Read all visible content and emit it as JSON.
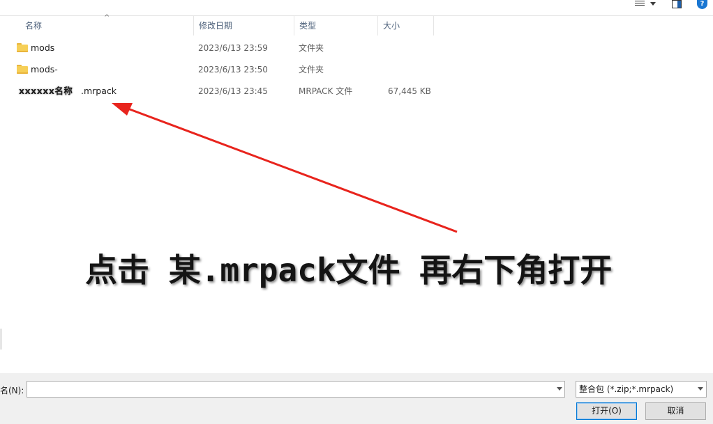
{
  "columns": {
    "name": "名称",
    "modified": "修改日期",
    "type": "类型",
    "size": "大小"
  },
  "sort_indicator": "^",
  "files": [
    {
      "name": "mods",
      "modified": "2023/6/13 23:59",
      "type": "文件夹",
      "size": "",
      "icon": "folder-icon"
    },
    {
      "name": "mods-",
      "modified": "2023/6/13 23:50",
      "type": "文件夹",
      "size": "",
      "icon": "folder-icon"
    },
    {
      "name_prefix": "xxxxxx名称",
      "name_suffix": ".mrpack",
      "modified": "2023/6/13 23:45",
      "type": "MRPACK 文件",
      "size": "67,445 KB",
      "icon": "none"
    }
  ],
  "annotation": {
    "text": "点击 某.mrpack文件 再右下角打开",
    "arrow_color": "#e8241d"
  },
  "help_glyph": "?",
  "bottom": {
    "filename_label": "名(N):",
    "filename_value": "",
    "filetype_selected": "整合包 (*.zip;*.mrpack)",
    "open_button": "打开(O)",
    "cancel_button": "取消"
  }
}
